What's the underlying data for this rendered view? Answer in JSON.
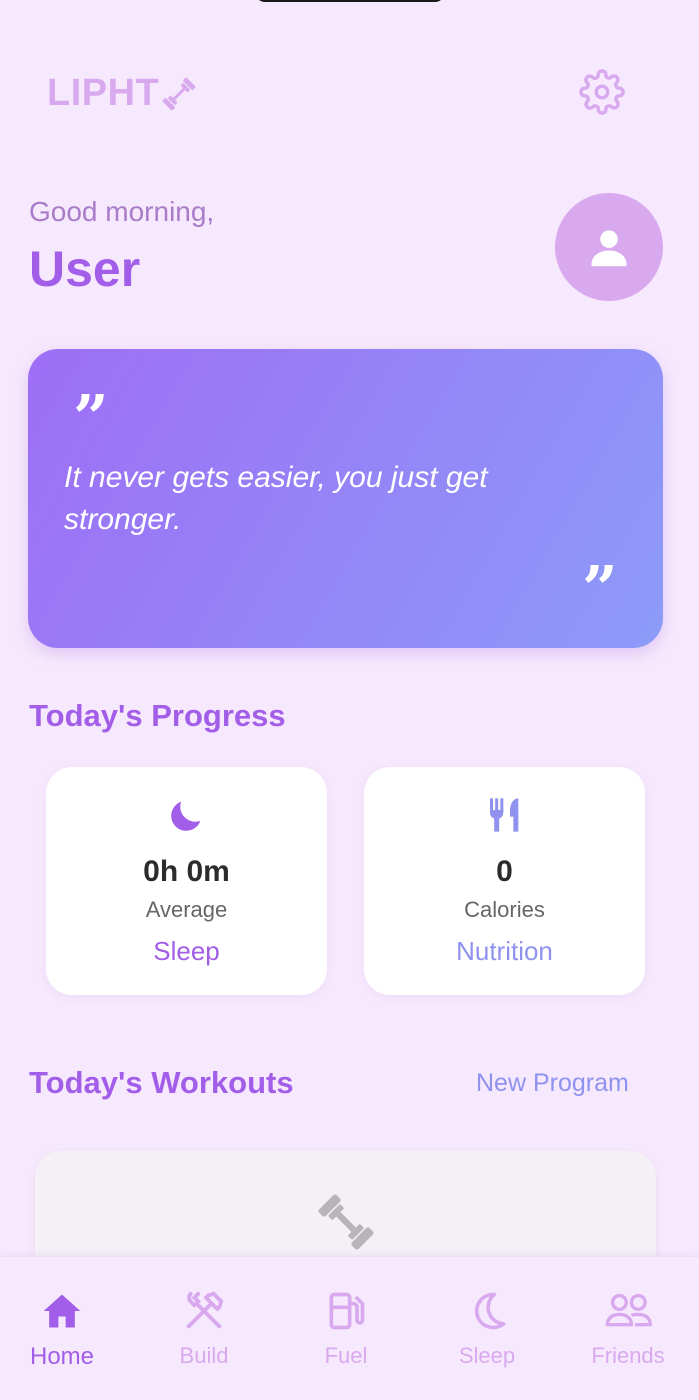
{
  "header": {
    "logo_text": "LIPHT",
    "logo_icon": "dumbbell-icon",
    "settings_icon": "gear-icon"
  },
  "greeting": {
    "salutation": "Good morning,",
    "name": "User",
    "avatar_icon": "person-icon"
  },
  "quote": {
    "text": "It never gets easier, you just get stronger.",
    "open_mark": "”",
    "close_mark": "”"
  },
  "progress": {
    "title": "Today's Progress",
    "cards": [
      {
        "icon": "moon-icon",
        "value": "0h 0m",
        "sub": "Average",
        "link": "Sleep"
      },
      {
        "icon": "fork-knife-icon",
        "value": "0",
        "sub": "Calories",
        "link": "Nutrition"
      }
    ]
  },
  "workouts": {
    "title": "Today's Workouts",
    "new_program": "New Program",
    "empty_icon": "dumbbell-icon"
  },
  "tabs": [
    {
      "label": "Home",
      "icon": "home-icon",
      "active": true
    },
    {
      "label": "Build",
      "icon": "tools-icon",
      "active": false
    },
    {
      "label": "Fuel",
      "icon": "fuel-pump-icon",
      "active": false
    },
    {
      "label": "Sleep",
      "icon": "moon-icon",
      "active": false
    },
    {
      "label": "Friends",
      "icon": "people-icon",
      "active": false
    }
  ],
  "colors": {
    "background": "#f7e9fd",
    "primary": "#a25ee8",
    "accent_blue": "#8f92ee",
    "soft_lilac": "#d8a9ee"
  }
}
